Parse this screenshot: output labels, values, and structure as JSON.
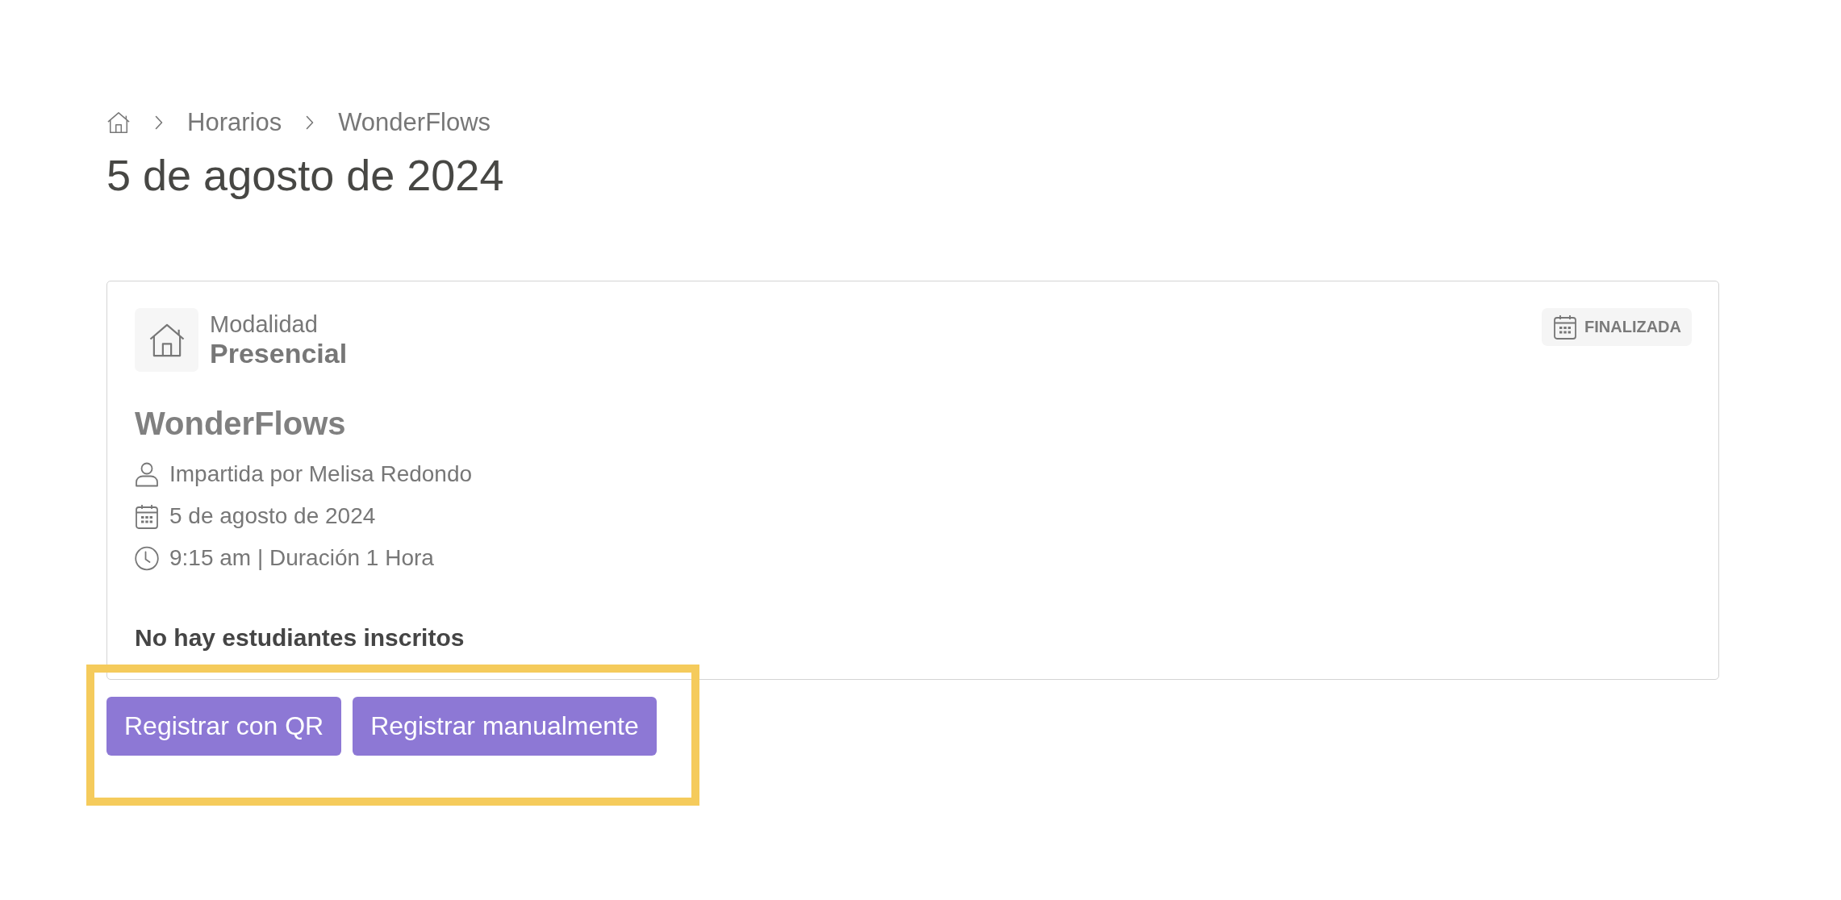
{
  "breadcrumb": [
    "Horarios",
    "WonderFlows"
  ],
  "title": "5 de agosto de 2024",
  "session": {
    "modality_label": "Modalidad",
    "modality": "Presencial",
    "status": "FINALIZADA",
    "name": "WonderFlows",
    "details": [
      {
        "kind": "instructor",
        "text": "Impartida por Melisa Redondo"
      },
      {
        "kind": "date",
        "text": "5 de agosto de 2024"
      },
      {
        "kind": "time",
        "text": "9:15 am | Duración 1 Hora"
      }
    ],
    "enrollment": "No hay estudiantes inscritos"
  },
  "actions": {
    "highlighted": true,
    "buttons": [
      "Registrar con QR",
      "Registrar manualmente"
    ]
  }
}
